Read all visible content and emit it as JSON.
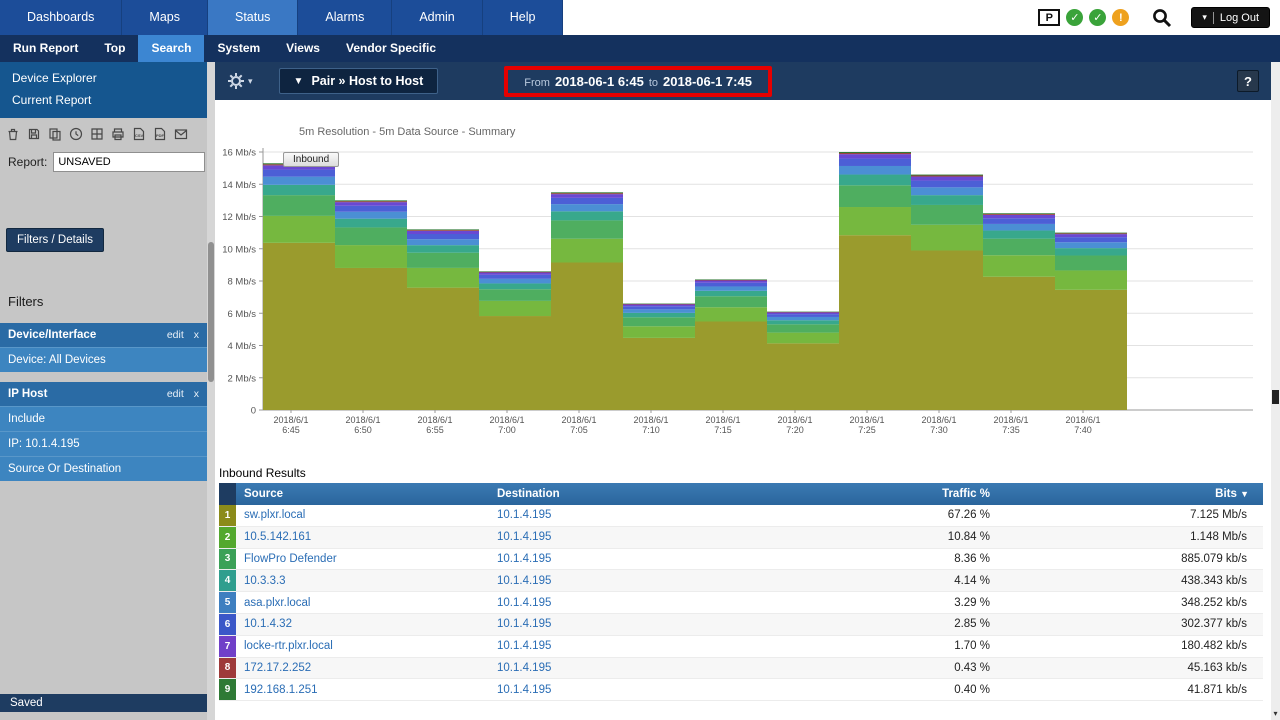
{
  "top_nav": {
    "items": [
      "Dashboards",
      "Maps",
      "Status",
      "Alarms",
      "Admin",
      "Help"
    ],
    "active": "Status",
    "status_icons": [
      {
        "name": "plixer-logo",
        "glyph": "P",
        "kind": "logo"
      },
      {
        "name": "health-ok-icon",
        "glyph": "✓",
        "kind": "circle",
        "color": "#3aa33a"
      },
      {
        "name": "health-ok-icon-2",
        "glyph": "✓",
        "kind": "circle",
        "color": "#3aa33a"
      },
      {
        "name": "warning-icon",
        "glyph": "!",
        "kind": "circle",
        "color": "#eea11e"
      }
    ],
    "logout": {
      "caret": "▾",
      "label": "Log Out"
    }
  },
  "sub_nav": {
    "items": [
      "Run Report",
      "Top",
      "Search",
      "System",
      "Views",
      "Vendor Specific"
    ],
    "active": "Search"
  },
  "sidebar": {
    "links": [
      "Device Explorer",
      "Current Report"
    ],
    "toolbar_icons": [
      "delete-report-icon",
      "save-report-icon",
      "copy-report-icon",
      "schedule-report-icon",
      "dashboard-grid-icon",
      "print-icon",
      "csv-export-icon",
      "pdf-export-icon",
      "email-report-icon"
    ],
    "report_label": "Report:",
    "report_value": "UNSAVED",
    "filters_details_button": "Filters / Details",
    "filters_heading": "Filters",
    "filter_groups": [
      {
        "title": "Device/Interface",
        "edit_label": "edit",
        "remove_label": "x",
        "rows": [
          "Device: All Devices"
        ]
      },
      {
        "title": "IP Host",
        "edit_label": "edit",
        "remove_label": "x",
        "rows": [
          "Include",
          "IP: 10.1.4.195",
          "Source Or Destination"
        ]
      }
    ],
    "saved_label": "Saved"
  },
  "report_bar": {
    "pair_caret": "▼",
    "pair_label": "Pair » Host to Host",
    "time_range": {
      "from_label": "From",
      "from_value": "2018-06-1 6:45",
      "to_label": "to",
      "to_value": "2018-06-1 7:45"
    },
    "help_label": "?"
  },
  "chart_data": {
    "type": "area",
    "stacked": true,
    "title": "5m Resolution - 5m Data Source - Summary",
    "direction_label": "Inbound",
    "ylim": [
      0,
      16
    ],
    "y_tick_step": 2,
    "y_unit": "Mb/s",
    "x_date_label": "2018/6/1",
    "x_times": [
      "6:45",
      "6:50",
      "6:55",
      "7:00",
      "7:05",
      "7:10",
      "7:15",
      "7:20",
      "7:25",
      "7:30",
      "7:35",
      "7:40"
    ],
    "totals_mbps": [
      15.3,
      13.0,
      11.2,
      8.6,
      13.5,
      6.6,
      8.1,
      6.1,
      16.0,
      14.6,
      12.2,
      11.0
    ],
    "series": [
      {
        "name": "sw.plxr.local",
        "percent": 67.26,
        "color": "#9a9b2d"
      },
      {
        "name": "10.5.142.161",
        "percent": 10.84,
        "color": "#76b83f"
      },
      {
        "name": "FlowPro Defender",
        "percent": 8.36,
        "color": "#4fae60"
      },
      {
        "name": "10.3.3.3",
        "percent": 4.14,
        "color": "#38a88c"
      },
      {
        "name": "asa.plxr.local",
        "percent": 3.29,
        "color": "#4b8fd4"
      },
      {
        "name": "10.1.4.32",
        "percent": 2.85,
        "color": "#4c5fd6"
      },
      {
        "name": "locke-rtr.plxr.local",
        "percent": 1.7,
        "color": "#6a48d2"
      },
      {
        "name": "172.17.2.252",
        "percent": 0.43,
        "color": "#9e3a3a"
      },
      {
        "name": "192.168.1.251",
        "percent": 0.4,
        "color": "#2f7a35"
      }
    ],
    "legend_position": "none",
    "grid": true
  },
  "table": {
    "section_title": "Inbound Results",
    "columns": [
      "Source",
      "Destination",
      "Traffic %",
      "Bits"
    ],
    "sort_indicator": "▼",
    "rows": [
      {
        "rank": 1,
        "color": "#8b8b1a",
        "source": "sw.plxr.local",
        "destination": "10.1.4.195",
        "traffic": "67.26 %",
        "bits": "7.125 Mb/s"
      },
      {
        "rank": 2,
        "color": "#53a82e",
        "source": "10.5.142.161",
        "destination": "10.1.4.195",
        "traffic": "10.84 %",
        "bits": "1.148 Mb/s"
      },
      {
        "rank": 3,
        "color": "#3ba157",
        "source": "FlowPro Defender",
        "destination": "10.1.4.195",
        "traffic": "8.36 %",
        "bits": "885.079 kb/s"
      },
      {
        "rank": 4,
        "color": "#2f9e8e",
        "source": "10.3.3.3",
        "destination": "10.1.4.195",
        "traffic": "4.14 %",
        "bits": "438.343 kb/s"
      },
      {
        "rank": 5,
        "color": "#3e7fc0",
        "source": "asa.plxr.local",
        "destination": "10.1.4.195",
        "traffic": "3.29 %",
        "bits": "348.252 kb/s"
      },
      {
        "rank": 6,
        "color": "#3b57c8",
        "source": "10.1.4.32",
        "destination": "10.1.4.195",
        "traffic": "2.85 %",
        "bits": "302.377 kb/s"
      },
      {
        "rank": 7,
        "color": "#7040c8",
        "source": "locke-rtr.plxr.local",
        "destination": "10.1.4.195",
        "traffic": "1.70 %",
        "bits": "180.482 kb/s"
      },
      {
        "rank": 8,
        "color": "#9e3a3a",
        "source": "172.17.2.252",
        "destination": "10.1.4.195",
        "traffic": "0.43 %",
        "bits": "45.163 kb/s"
      },
      {
        "rank": 9,
        "color": "#2f7a35",
        "source": "192.168.1.251",
        "destination": "10.1.4.195",
        "traffic": "0.40 %",
        "bits": "41.871 kb/s"
      }
    ]
  }
}
